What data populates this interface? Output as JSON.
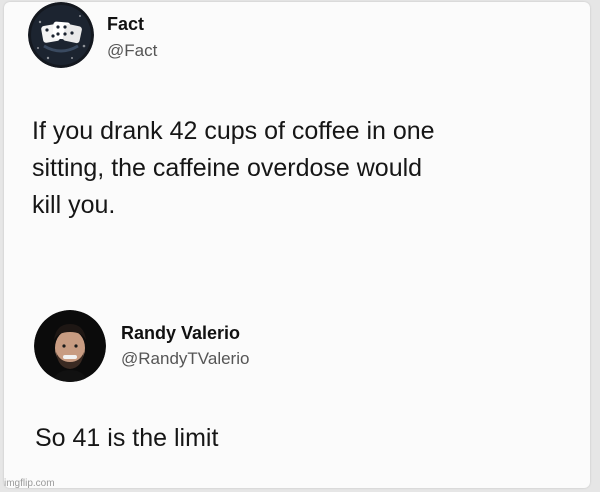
{
  "original_post": {
    "author_name": "Fact",
    "author_handle": "@Fact",
    "avatar_icon": "dice-logo-icon",
    "text_lines": [
      "If you drank 42 cups of coffee in one",
      "sitting, the caffeine overdose would",
      "kill you."
    ]
  },
  "reply": {
    "author_name": "Randy Valerio",
    "author_handle": "@RandyTValerio",
    "avatar_icon": "profile-photo-icon",
    "text": "So 41 is the limit"
  },
  "watermark": "imgflip.com",
  "colors": {
    "background": "#e6e6e6",
    "card": "#fbfbfb",
    "text": "#161616",
    "handle": "#555555"
  }
}
